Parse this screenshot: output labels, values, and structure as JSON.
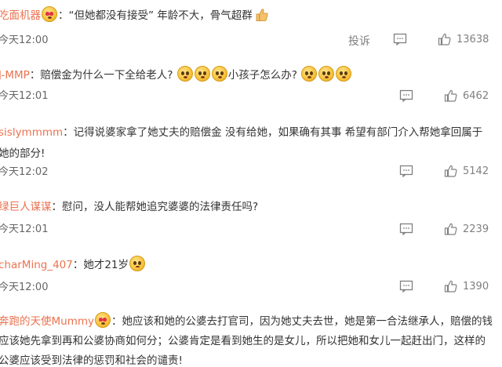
{
  "comments": [
    {
      "user": "吃面机器",
      "emoji_after_name": "heart-eyes-emoji",
      "separator": "：",
      "text": "“但她都没有接受” 年龄不大，骨气超群",
      "trailing_icon": "thumbs-up-emoji",
      "time": "今天12:00",
      "report_label": "投诉",
      "likes": "13638"
    },
    {
      "user": "J-MMP",
      "separator": "：",
      "text_a": "赔偿金为什么一下全给老人?",
      "text_b": "小孩子怎么办?",
      "emoji": "thinking-face-emoji",
      "time": "今天12:01",
      "likes": "6462"
    },
    {
      "user": "sislymmmm",
      "separator": "：",
      "text": "记得说婆家拿了她丈夫的赔偿金 没有给她，如果确有其事 希望有部门介入帮她拿回属于她的部分!",
      "time": "今天12:02",
      "likes": "5142"
    },
    {
      "user": "绿巨人谋谋",
      "separator": "：",
      "text": "慰问，没人能帮她追究婆婆的法律责任吗?",
      "time": "今天12:01",
      "likes": "2239"
    },
    {
      "user": "charMing_407",
      "separator": "：",
      "text": "她才21岁",
      "emoji": "sad-face-emoji",
      "time": "今天12:00",
      "likes": "1390"
    },
    {
      "user": "奔跑的天使Mummy",
      "emoji_after_name": "heart-eyes-emoji",
      "separator": "：",
      "text": "她应该和她的公婆去打官司，因为她丈夫去世，她是第一合法继承人，赔偿的钱应该她先拿到再和公婆协商如何分；公婆肯定是看到她生的是女儿，所以把她和女儿一起赶出门，这样的公婆应该受到法律的惩罚和社会的谴责!"
    }
  ]
}
